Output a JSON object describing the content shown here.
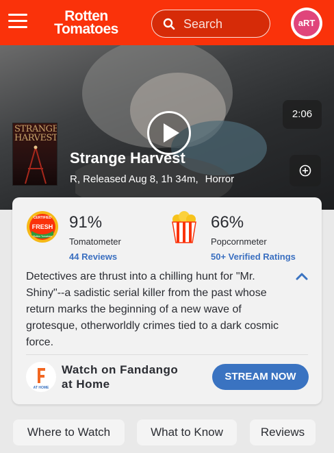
{
  "header": {
    "logo_line1": "Rotten",
    "logo_line2": "Tomatoes",
    "search_placeholder": "Search",
    "avatar_text": "aRT",
    "brand_color": "#fa320a"
  },
  "hero": {
    "duration": "2:06",
    "poster_text": "STRANGE HARVEST",
    "title": "Strange Harvest",
    "meta": "R, Released Aug 8, 1h 34m,",
    "genre": "Horror"
  },
  "scores": {
    "tomatometer": {
      "value": "91%",
      "label": "Tomatometer",
      "link": "44 Reviews",
      "badge_top": "CERTIFIED",
      "badge_mid": "FRESH",
      "badge_bottom": "Rotten Tomatoes"
    },
    "popcornmeter": {
      "value": "66%",
      "label": "Popcornmeter",
      "link": "50+ Verified Ratings"
    }
  },
  "synopsis": "Detectives are thrust into a chilling hunt for \"Mr. Shiny\"--a sadistic serial killer from the past whose return marks the beginning of a new wave of grotesque, otherworldly crimes tied to a dark cosmic force.",
  "fandango": {
    "line1": "Watch on Fandango",
    "line2": "at Home",
    "icon_text": "AT HOME",
    "cta": "STREAM NOW",
    "cta_color": "#3a73c1"
  },
  "nav": {
    "where_to_watch": "Where to Watch",
    "what_to_know": "What to Know",
    "reviews": "Reviews"
  }
}
